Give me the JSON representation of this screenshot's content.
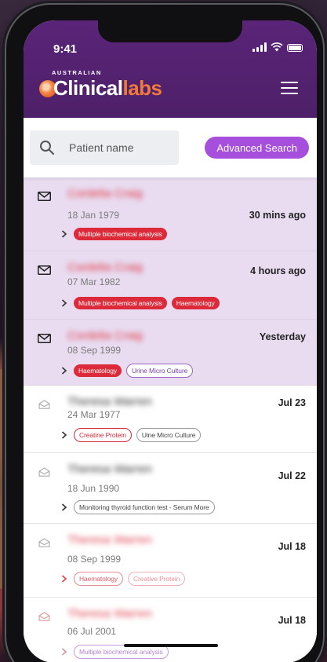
{
  "status_bar": {
    "time": "9:41"
  },
  "brand": {
    "top": "AUSTRALIAN",
    "clinical": "Clinical",
    "labs": "labs"
  },
  "search": {
    "placeholder": "Patient name",
    "advanced_label": "Advanced Search"
  },
  "results": [
    {
      "date": "18 Jan 1979",
      "time": "30 mins ago",
      "read": false,
      "tags": [
        "Multiple biochemical analysis"
      ]
    },
    {
      "date": "07 Mar 1982",
      "time": "4 hours ago",
      "read": false,
      "tags": [
        "Multiple biochemical analysis",
        "Haematology"
      ]
    },
    {
      "date": "08 Sep 1999",
      "time": "Yesterday",
      "read": false,
      "tags": [
        "Haematology",
        "Urine Micro Culture"
      ]
    },
    {
      "date": "24 Mar 1977",
      "time": "Jul 23",
      "read": true,
      "tags": [
        "Creatine Protein",
        "Uine Micro Culture"
      ]
    },
    {
      "date": "18 Jun 1990",
      "time": "Jul 22",
      "read": true,
      "tags": [
        "Monitoring thyroid function test - Serum More"
      ]
    },
    {
      "date": "08 Sep 1999",
      "time": "Jul 18",
      "read": true,
      "tags": [
        "Haematology",
        "Creative Protein"
      ]
    },
    {
      "date": "06 Jul 2001",
      "time": "Jul 18",
      "read": true,
      "tags": [
        "Multiple biochemical analysis"
      ]
    }
  ],
  "colors": {
    "header_purple": "#5a2478",
    "accent_orange": "#f07a3c",
    "button_purple": "#a64fdd",
    "unread_row": "#e9dcf1",
    "tag_red": "#dc2a3a"
  }
}
